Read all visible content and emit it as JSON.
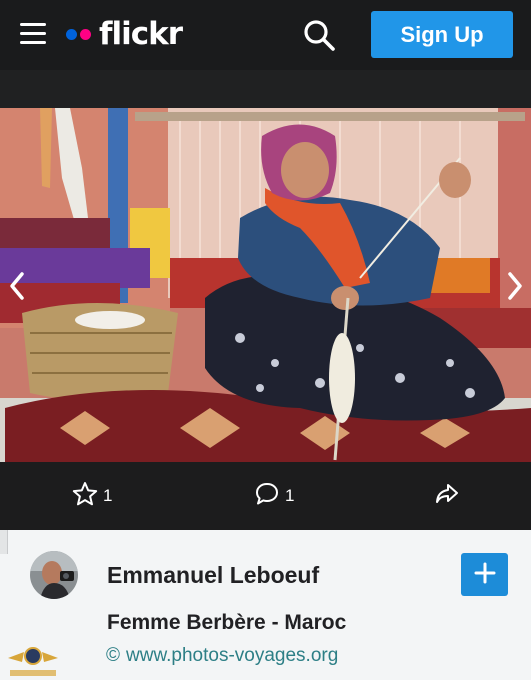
{
  "header": {
    "logo_text": "flickr",
    "signup_label": "Sign Up",
    "icons": [
      "menu-icon",
      "search-icon"
    ],
    "colors": {
      "logo_blue": "#0063dc",
      "logo_pink": "#ff0084",
      "signup_bg": "#2196e8"
    }
  },
  "photo": {
    "icons": [
      "chevron-left-icon",
      "chevron-right-icon"
    ]
  },
  "actions": {
    "favorites_count": "1",
    "comments_count": "1",
    "icons": [
      "star-icon",
      "comment-icon",
      "share-icon"
    ]
  },
  "info": {
    "author_name": "Emmanuel Leboeuf",
    "photo_title": "Femme Berbère - Maroc",
    "copyright_symbol": "©",
    "website": "www.photos-voyages.org",
    "follow_icon": "plus-icon",
    "colors": {
      "follow_bg": "#1d8cd8",
      "link": "#2d7f86"
    }
  }
}
